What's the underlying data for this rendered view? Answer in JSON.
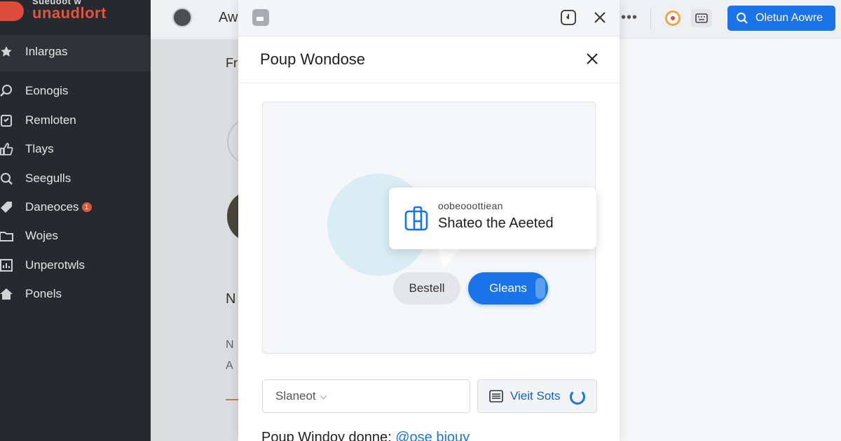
{
  "brand": {
    "tagline": "Sueuoot w",
    "name": "unaudlort"
  },
  "sidebar": {
    "items": [
      {
        "label": "Inlargas",
        "icon": "star-icon"
      },
      {
        "label": "Eonogis",
        "icon": "search-icon"
      },
      {
        "label": "Remloten",
        "icon": "clipboard-icon"
      },
      {
        "label": "Tlays",
        "icon": "thumbs-up-icon"
      },
      {
        "label": "Seegulls",
        "icon": "search-icon"
      },
      {
        "label": "Daneoces",
        "icon": "tag-icon",
        "badge": "1"
      },
      {
        "label": "Wojes",
        "icon": "folder-icon"
      },
      {
        "label": "Unperotwls",
        "icon": "chart-icon"
      },
      {
        "label": "Ponels",
        "icon": "home-icon"
      }
    ]
  },
  "topbar": {
    "text": "Aw",
    "more": "•••",
    "primary_button": "Oletun Aowre"
  },
  "content": {
    "letters": [
      "Fr",
      "N",
      "N",
      "A"
    ]
  },
  "popup": {
    "title": "Poup Wondose",
    "tooltip_small": "oobeooottiean",
    "tooltip_main": "Shateo the Aeeted",
    "secondary_button": "Bestell",
    "primary_button": "Gleans",
    "select_value": "Slaneot",
    "view_button": "Vieit Sots",
    "footer_text": "Poup Windoy donne:",
    "footer_link": "@ose biouy"
  },
  "colors": {
    "accent": "#1a73e8",
    "sidebar": "#262a2e",
    "brand": "#e2543f"
  }
}
